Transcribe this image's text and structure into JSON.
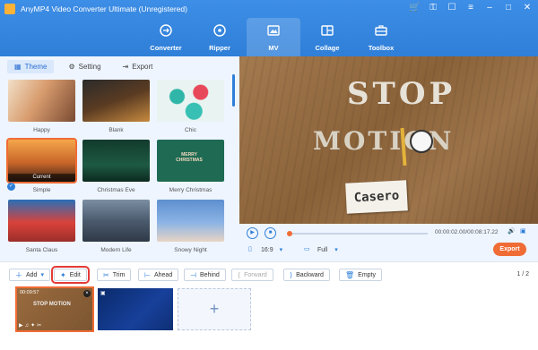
{
  "app": {
    "title": "AnyMP4 Video Converter Ultimate (Unregistered)",
    "window_icons": [
      "cart-icon",
      "key-icon",
      "chat-icon",
      "menu-icon",
      "minimize-icon",
      "maximize-icon",
      "close-icon"
    ]
  },
  "nav": {
    "tabs": [
      {
        "label": "Converter",
        "icon": "converter-icon",
        "active": false
      },
      {
        "label": "Ripper",
        "icon": "ripper-icon",
        "active": false
      },
      {
        "label": "MV",
        "icon": "mv-icon",
        "active": true
      },
      {
        "label": "Collage",
        "icon": "collage-icon",
        "active": false
      },
      {
        "label": "Toolbox",
        "icon": "toolbox-icon",
        "active": false
      }
    ]
  },
  "subtabs": [
    {
      "label": "Theme",
      "icon": "grid-icon",
      "active": true
    },
    {
      "label": "Setting",
      "icon": "gear-icon",
      "active": false
    },
    {
      "label": "Export",
      "icon": "export-icon",
      "active": false
    }
  ],
  "themes": [
    {
      "name": "Happy",
      "selected": false
    },
    {
      "name": "Blank",
      "selected": false
    },
    {
      "name": "Chic",
      "selected": false
    },
    {
      "name": "Simple",
      "selected": true,
      "badge": "Current"
    },
    {
      "name": "Christmas Eve",
      "selected": false
    },
    {
      "name": "Merry Christmas",
      "selected": false,
      "overlay": "MERRY CHRISTMAS"
    },
    {
      "name": "Santa Claus",
      "selected": false
    },
    {
      "name": "Modern Life",
      "selected": false
    },
    {
      "name": "Snowy Night",
      "selected": false
    }
  ],
  "preview": {
    "line1": "STOP",
    "line2": "MOTION",
    "caption": "Casero"
  },
  "player": {
    "time": "00:00:02.00/00:08:17.22",
    "ratio": "16:9",
    "size": "Full",
    "progress_percent": 0,
    "export_label": "Export"
  },
  "toolbar": {
    "add": "Add",
    "edit": "Edit",
    "trim": "Trim",
    "ahead": "Ahead",
    "behind": "Behind",
    "forward": "Forward",
    "backward": "Backward",
    "empty": "Empty",
    "page": "1 / 2"
  },
  "clips": [
    {
      "duration": "00:09:57",
      "title": "STOP MOTION"
    }
  ],
  "colors": {
    "brand_blue": "#2f7fd8",
    "accent_orange": "#f06c35",
    "highlight_red": "#e53935"
  }
}
